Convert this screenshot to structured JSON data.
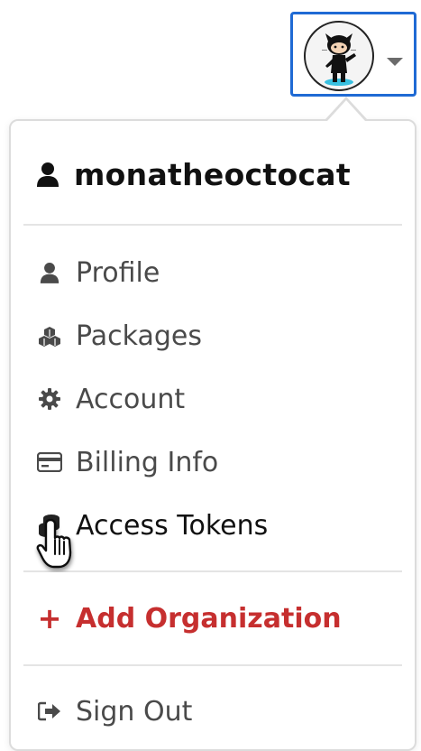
{
  "user": {
    "username": "monatheoctocat",
    "avatar_icon": "octocat-avatar"
  },
  "menu": {
    "items": [
      {
        "label": "Profile",
        "icon": "user-icon"
      },
      {
        "label": "Packages",
        "icon": "cubes-icon"
      },
      {
        "label": "Account",
        "icon": "gear-icon"
      },
      {
        "label": "Billing Info",
        "icon": "credit-card-icon"
      },
      {
        "label": "Access Tokens",
        "icon": "coins-icon"
      }
    ],
    "add_org": {
      "label": "Add Organization",
      "symbol": "+"
    },
    "sign_out": {
      "label": "Sign Out",
      "icon": "sign-out-icon"
    }
  },
  "colors": {
    "accent": "#1f6ad4",
    "danger": "#c62f2f",
    "text": "#4a4a4a"
  }
}
